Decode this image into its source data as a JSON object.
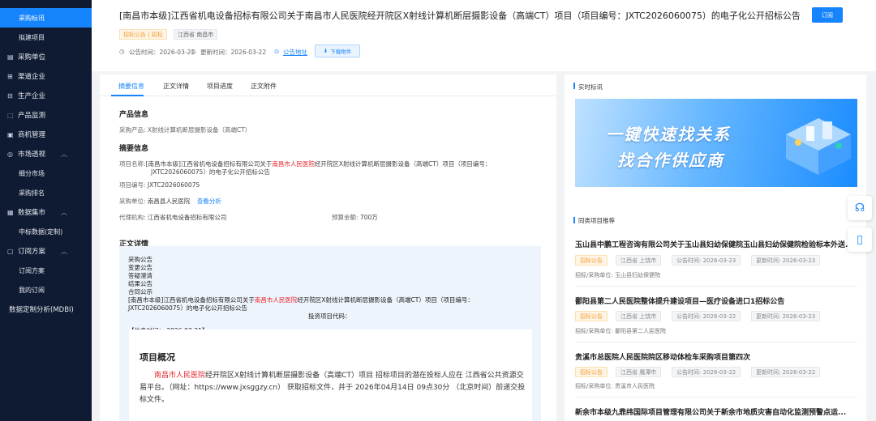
{
  "sidebar": {
    "items": [
      {
        "label": "采购标讯",
        "icon": "",
        "type": "sub-active"
      },
      {
        "label": "拟建项目",
        "icon": "",
        "type": "sub"
      },
      {
        "label": "采购单位",
        "icon": "▤",
        "type": "main"
      },
      {
        "label": "渠道企业",
        "icon": "⊞",
        "type": "main"
      },
      {
        "label": "生产企业",
        "icon": "⊟",
        "type": "main"
      },
      {
        "label": "产品监测",
        "icon": "⬚",
        "type": "main"
      },
      {
        "label": "商机管理",
        "icon": "▣",
        "type": "main"
      },
      {
        "label": "市场透视",
        "icon": "◎",
        "type": "main",
        "arrow": "︿"
      },
      {
        "label": "细分市场",
        "icon": "",
        "type": "sub"
      },
      {
        "label": "采购排名",
        "icon": "",
        "type": "sub"
      },
      {
        "label": "数据集市",
        "icon": "▦",
        "type": "main",
        "arrow": "︿"
      },
      {
        "label": "中标数据(定制)",
        "icon": "",
        "type": "sub"
      },
      {
        "label": "订阅方案",
        "icon": "▢",
        "type": "main",
        "arrow": "︿"
      },
      {
        "label": "订阅方案",
        "icon": "",
        "type": "sub"
      },
      {
        "label": "我的订阅",
        "icon": "",
        "type": "sub"
      },
      {
        "label": "数据定制分析(MDBI)",
        "icon": "",
        "type": "plain"
      }
    ]
  },
  "header": {
    "title": "[南昌市本级]江西省机电设备招标有限公司关于南昌市人民医院经开院区X射线计算机断层摄影设备（高端CT）项目（项目编号：JXTC2026060075）的电子化公开招标公告",
    "subscribe": "订阅",
    "tag_type": "招标公告 | 招标",
    "tag_region": "江西省 南昌市",
    "publish_time": "公告时间：2026-03-21",
    "update_time": "更新时间：2026-03-22",
    "address_link": "公告地址",
    "download": "下载附件"
  },
  "tabs": [
    "摘要信息",
    "正文详情",
    "项目进度",
    "正文附件"
  ],
  "product": {
    "heading": "产品信息",
    "line": "采购产品: X射线计算机断层摄影设备（高端CT）"
  },
  "summary": {
    "heading": "摘要信息",
    "name_label": "项目名称:",
    "name_a": "[南昌市本级]江西省机电设备招标有限公司关于",
    "name_red": "南昌市人民医院",
    "name_b": "经开院区X射线计算机断层摄影设备（高端CT）项目（项目编号：",
    "name_c": "JXTC2026060075）的电子化公开招标公告",
    "code_label": "项目编号:",
    "code": "JXTC2026060075",
    "unit_label": "采购单位:",
    "unit": "南昌县人民医院",
    "unit_link": "查看分析",
    "agent_label": "代理机构:",
    "agent": "江西省机电设备招标有限公司",
    "budget_label": "预算金额:",
    "budget": "700万"
  },
  "detail": {
    "heading": "正文详情",
    "lines": [
      "采购公告",
      "变更公告",
      "答疑澄清",
      "结果公告",
      "合同公示"
    ],
    "title_a": "[南昌市本级]江西省机电设备招标有限公司关于",
    "title_red": "南昌市人民医院",
    "title_b": "经开院区X射线计算机断层摄影设备（高端CT）项目（项目编号：",
    "title_c": "JXTC2026060075）的电子化公开招标公告",
    "invest_code": "投资项目代码：",
    "info_time": "【信息时间： 2026-03-21】",
    "overview_h": "项目概况",
    "overview_red": "南昌市人民医院",
    "overview_a": "经开院区X射线计算机断层摄影设备（高端CT）项目 招标项目的潜在投标人应在 江西省公共资源交",
    "overview_b": "易平台。（网址：https://www.jxsggzy.cn） 获取招标文件，并于 2026年04月14日 09点30分 （北京时间）前递交投",
    "overview_c": "标文件。"
  },
  "right": {
    "realtime": "实时标讯",
    "banner1": "一键快速找关系",
    "banner2": "找合作供应商",
    "similar_h": "同类项目推荐",
    "items": [
      {
        "title": "玉山县中鹏工程咨询有限公司关于玉山县妇幼保健院玉山县妇幼保健院检验标本外送...",
        "tag": "招标公告",
        "region": "江西省 上饶市",
        "pub": "公告时间: 2026-03-23",
        "upd": "更新时间: 2026-03-23",
        "unit": "招标/采购单位: 玉山县妇幼保健院"
      },
      {
        "title": "鄱阳县第二人民医院整体提升建设项目—医疗设备进口1招标公告",
        "tag": "招标公告",
        "region": "江西省 上饶市",
        "pub": "公告时间: 2026-03-22",
        "upd": "更新时间: 2026-03-23",
        "unit": "招标/采购单位: 鄱阳县第二人民医院"
      },
      {
        "title": "贵溪市总医院人民医院院区移动体检车采购项目第四次",
        "tag": "招标公告",
        "region": "江西省 鹰潭市",
        "pub": "公告时间: 2026-03-22",
        "upd": "更新时间: 2026-03-22",
        "unit": "招标/采购单位: 贵溪市人民医院"
      },
      {
        "title": "新余市本级九鼎纬国际项目管理有限公司关于新余市地质灾害自动化监测预警点运...",
        "tag": "",
        "region": "",
        "pub": "",
        "upd": "",
        "unit": ""
      }
    ]
  },
  "colors": {
    "accent": "#1684fc",
    "sidebar_bg": "#0f1b33",
    "tag_orange": "#f0a236",
    "highlight_red": "#e5262d"
  },
  "float": {
    "service_icon": "headset-icon",
    "phone_icon": "phone-icon"
  }
}
